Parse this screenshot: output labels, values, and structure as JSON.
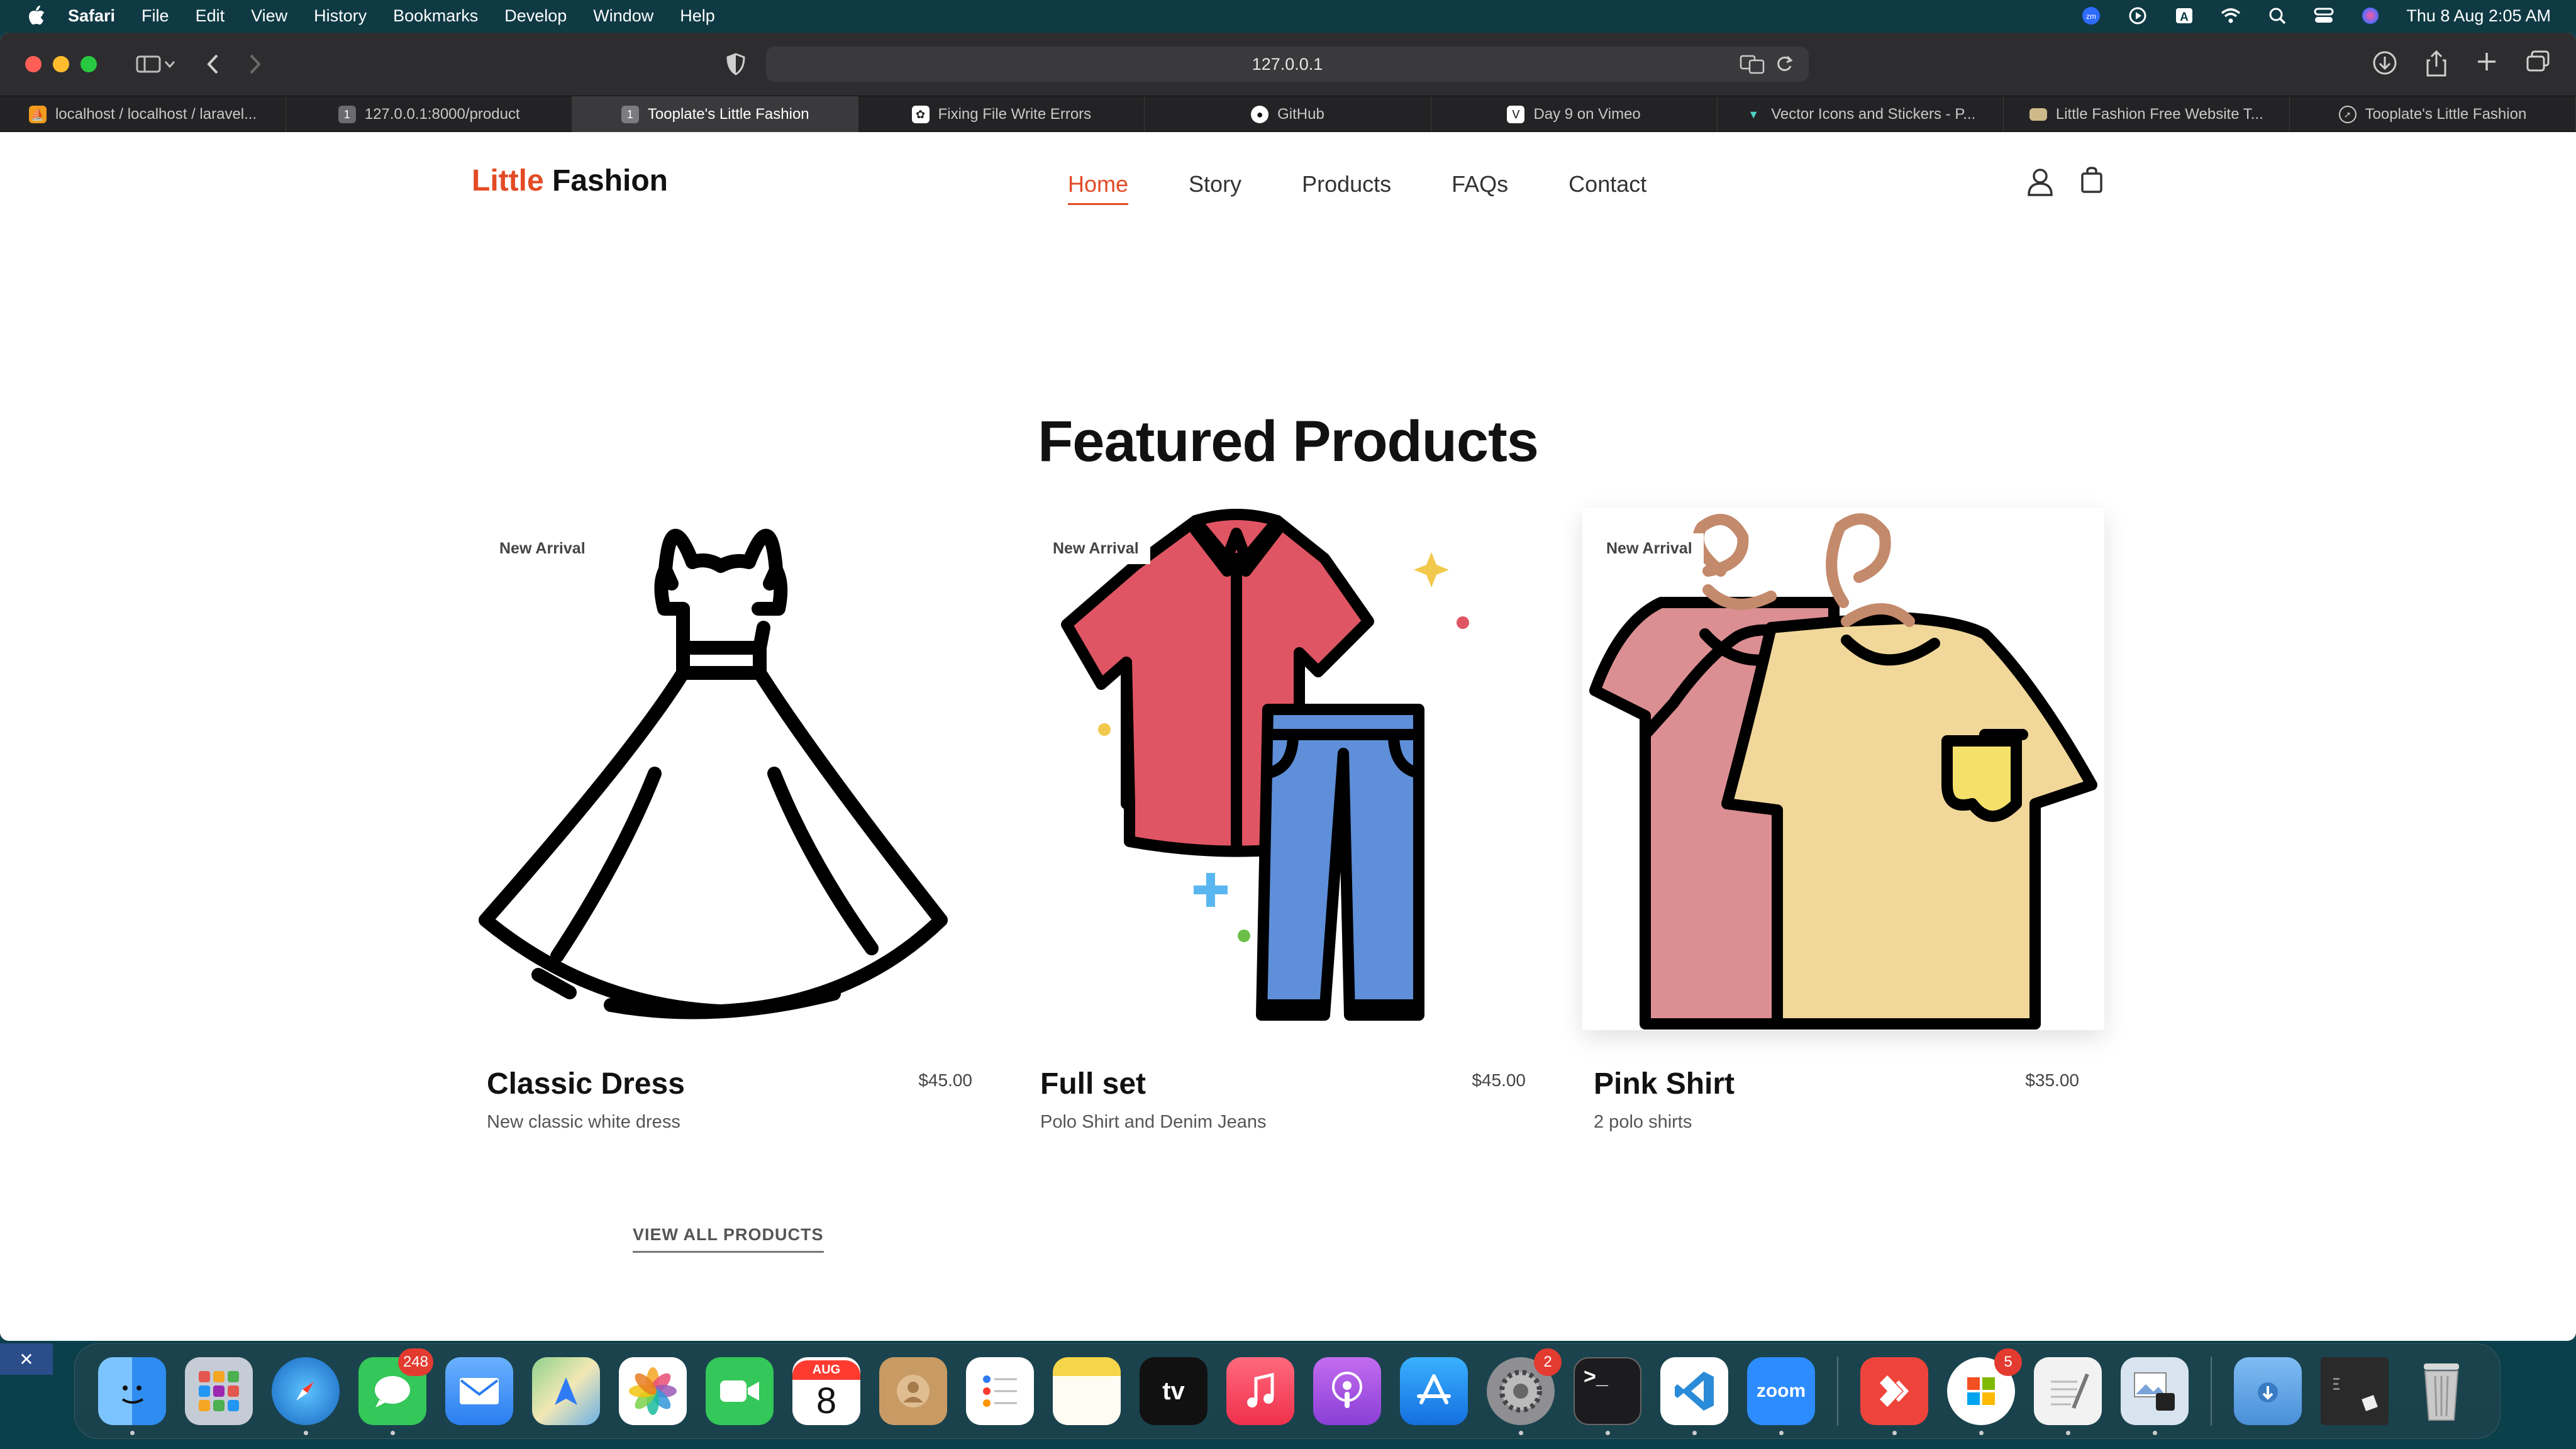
{
  "menubar": {
    "app": "Safari",
    "items": [
      "File",
      "Edit",
      "View",
      "History",
      "Bookmarks",
      "Develop",
      "Window",
      "Help"
    ],
    "clock": "Thu 8 Aug  2:05 AM",
    "status_icons": [
      "zoom-icon",
      "play-icon",
      "keyboard-input-icon",
      "wifi-icon",
      "spotlight-icon",
      "control-center-icon",
      "siri-icon"
    ]
  },
  "browser": {
    "url": "127.0.0.1",
    "tabs": [
      {
        "label": "localhost / localhost / laravel...",
        "icon": "phpmyadmin-icon",
        "active": false
      },
      {
        "label": "127.0.0.1:8000/product",
        "icon": "page-icon",
        "active": false
      },
      {
        "label": "Tooplate's Little Fashion",
        "icon": "page-icon",
        "active": true
      },
      {
        "label": "Fixing File Write Errors",
        "icon": "chatgpt-icon",
        "active": false
      },
      {
        "label": "GitHub",
        "icon": "github-icon",
        "active": false
      },
      {
        "label": "Day 9 on Vimeo",
        "icon": "vimeo-icon",
        "active": false
      },
      {
        "label": "Vector Icons and Stickers - P...",
        "icon": "flaticon-icon",
        "active": false
      },
      {
        "label": "Little Fashion Free Website T...",
        "icon": "page-icon",
        "active": false
      },
      {
        "label": "Tooplate's Little Fashion",
        "icon": "compass-icon",
        "active": false
      }
    ]
  },
  "site": {
    "brand_accent": "Little",
    "brand_rest": " Fashion",
    "nav": [
      {
        "label": "Home",
        "active": true
      },
      {
        "label": "Story",
        "active": false
      },
      {
        "label": "Products",
        "active": false
      },
      {
        "label": "FAQs",
        "active": false
      },
      {
        "label": "Contact",
        "active": false
      }
    ],
    "section_title": "Featured Products",
    "products": [
      {
        "badge": "New Arrival",
        "name": "Classic Dress",
        "price": "$45.00",
        "desc": "New classic white dress",
        "image": "dress-icon"
      },
      {
        "badge": "New Arrival",
        "name": "Full set",
        "price": "$45.00",
        "desc": "Polo Shirt and Denim Jeans",
        "image": "shirt-jeans-icon"
      },
      {
        "badge": "New Arrival",
        "name": "Pink Shirt",
        "price": "$35.00",
        "desc": "2 polo shirts",
        "image": "shirts-on-hangers-icon"
      }
    ],
    "view_all": "VIEW ALL PRODUCTS"
  },
  "dock": {
    "items": [
      {
        "name": "finder",
        "label": "",
        "color": "#2f8cf0",
        "running": true
      },
      {
        "name": "launchpad",
        "label": "",
        "color": "#b9c3d0",
        "running": false
      },
      {
        "name": "safari",
        "label": "",
        "color": "#1e88e5",
        "running": true
      },
      {
        "name": "messages",
        "label": "",
        "color": "#34c759",
        "running": true,
        "badge": "248"
      },
      {
        "name": "mail",
        "label": "",
        "color": "#3b8df5",
        "running": false
      },
      {
        "name": "maps",
        "label": "",
        "color": "#5fbf6a",
        "running": false
      },
      {
        "name": "photos",
        "label": "",
        "color": "#f4f4f4",
        "running": false
      },
      {
        "name": "facetime",
        "label": "",
        "color": "#2fc75a",
        "running": false
      },
      {
        "name": "calendar",
        "label": "8",
        "month": "AUG",
        "color": "#ffffff",
        "running": false
      },
      {
        "name": "contacts",
        "label": "",
        "color": "#c89a64",
        "running": false
      },
      {
        "name": "reminders",
        "label": "",
        "color": "#ffffff",
        "running": false
      },
      {
        "name": "notes",
        "label": "",
        "color": "#f7d54a",
        "running": false
      },
      {
        "name": "apple-tv",
        "label": "tv",
        "color": "#111111",
        "running": false
      },
      {
        "name": "music",
        "label": "",
        "color": "#f6425a",
        "running": false
      },
      {
        "name": "podcasts",
        "label": "",
        "color": "#9b4ee0",
        "running": false
      },
      {
        "name": "app-store",
        "label": "",
        "color": "#1f8ef5",
        "running": false
      },
      {
        "name": "system-settings",
        "label": "",
        "color": "#8e8e93",
        "running": true,
        "badge": "2"
      },
      {
        "name": "terminal",
        "label": ">_",
        "color": "#1c1c1e",
        "running": true
      },
      {
        "name": "vscode",
        "label": "",
        "color": "#2a8bd8",
        "running": true
      },
      {
        "name": "zoom",
        "label": "zoom",
        "color": "#2d8cff",
        "running": true
      },
      {
        "name": "anydesk",
        "label": "",
        "color": "#ef443b",
        "running": true
      },
      {
        "name": "microsoft-store",
        "label": "",
        "color": "#ffffff",
        "running": true,
        "badge": "5"
      },
      {
        "name": "textedit",
        "label": "",
        "color": "#f2f2f2",
        "running": true
      },
      {
        "name": "preview",
        "label": "",
        "color": "#d8e4ef",
        "running": true
      },
      {
        "name": "downloads-folder",
        "label": "",
        "color": "#64a8e8",
        "running": false
      },
      {
        "name": "screen-window",
        "label": "",
        "color": "#2a2a2a",
        "running": false
      },
      {
        "name": "trash",
        "label": "",
        "color": "#c9c9c9",
        "running": false
      }
    ]
  },
  "colors": {
    "accent": "#e34b25",
    "dress_line": "#000000",
    "shirt_red": "#e05563",
    "jeans_blue": "#5e8fd8",
    "tshirt_yellow": "#f1d89a",
    "tshirt_pink": "#dc8f93"
  }
}
